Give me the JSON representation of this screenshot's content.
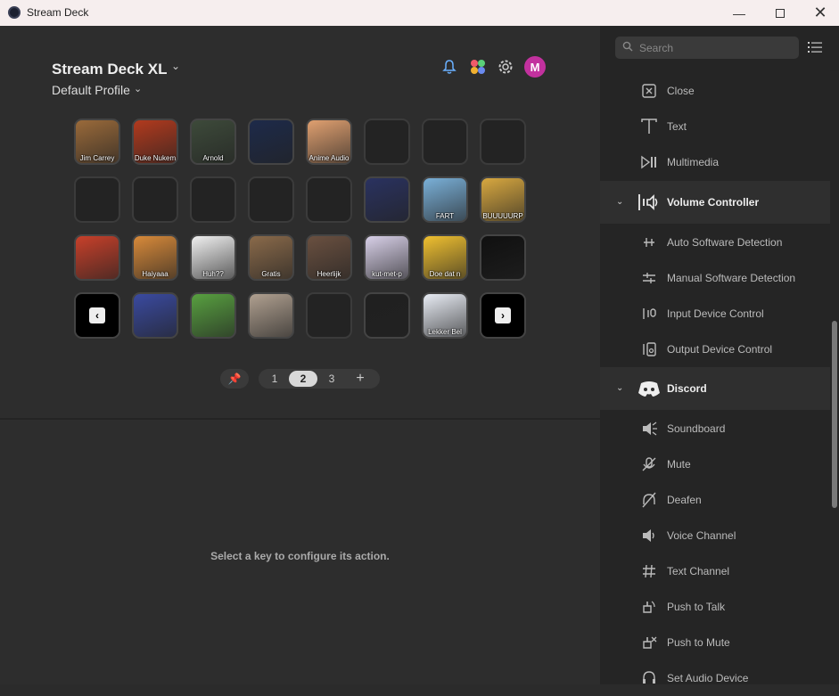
{
  "window": {
    "title": "Stream Deck"
  },
  "deck": {
    "name": "Stream Deck XL",
    "profile": "Default Profile"
  },
  "header_icons": [
    "bell-icon",
    "plugin-store-icon",
    "gear-icon"
  ],
  "avatar_initial": "M",
  "keys": [
    {
      "label": "Jim Carrey",
      "bg": "#9a6a3a"
    },
    {
      "label": "Duke Nukem",
      "bg": "#b23a1e"
    },
    {
      "label": "Arnold",
      "bg": "#3d4a3a"
    },
    {
      "label": "",
      "bg": "#1d2a4a"
    },
    {
      "label": "Anime Audio",
      "bg": "#e0a070"
    },
    {
      "label": "",
      "bg": ""
    },
    {
      "label": "",
      "bg": ""
    },
    {
      "label": "",
      "bg": ""
    },
    {
      "label": "",
      "bg": ""
    },
    {
      "label": "",
      "bg": ""
    },
    {
      "label": "",
      "bg": ""
    },
    {
      "label": "",
      "bg": ""
    },
    {
      "label": "",
      "bg": ""
    },
    {
      "label": "",
      "bg": "#2a3260"
    },
    {
      "label": "FART",
      "bg": "#7ab0d8"
    },
    {
      "label": "BUUUUURP",
      "bg": "#d8a840"
    },
    {
      "label": "",
      "bg": "#c8402a"
    },
    {
      "label": "Haiyaaa",
      "bg": "#d88a3a"
    },
    {
      "label": "Huh??",
      "bg": "#f0f0f0"
    },
    {
      "label": "Gratis",
      "bg": "#8a6a4a"
    },
    {
      "label": "Heerlijk",
      "bg": "#6a5040"
    },
    {
      "label": "kut-met-p",
      "bg": "#d8d0e8"
    },
    {
      "label": "Doe dat n",
      "bg": "#f0c030"
    },
    {
      "label": "",
      "bg": "#101010"
    },
    {
      "label": "",
      "bg": "nav-prev"
    },
    {
      "label": "",
      "bg": "#3a4aa0"
    },
    {
      "label": "",
      "bg": "#58a040"
    },
    {
      "label": "",
      "bg": "#b0a090"
    },
    {
      "label": "",
      "bg": ""
    },
    {
      "label": "",
      "bg": "#202020"
    },
    {
      "label": "Lekker Bel",
      "bg": "#e8ecf4"
    },
    {
      "label": "",
      "bg": "nav-next"
    }
  ],
  "pager": {
    "pages": [
      "1",
      "2",
      "3"
    ],
    "active": "2",
    "add": "+"
  },
  "hint": "Select a key to configure its action.",
  "sidebar": {
    "search_placeholder": "Search",
    "items_top": [
      {
        "label": "Close",
        "icon": "close-box-icon"
      },
      {
        "label": "Text",
        "icon": "text-icon"
      },
      {
        "label": "Multimedia",
        "icon": "play-pause-icon"
      }
    ],
    "volume": {
      "title": "Volume Controller",
      "items": [
        {
          "label": "Auto Software Detection",
          "icon": "auto-slider-icon"
        },
        {
          "label": "Manual Software Detection",
          "icon": "manual-slider-icon"
        },
        {
          "label": "Input Device Control",
          "icon": "input-device-icon"
        },
        {
          "label": "Output Device Control",
          "icon": "output-device-icon"
        }
      ]
    },
    "discord": {
      "title": "Discord",
      "items": [
        {
          "label": "Soundboard",
          "icon": "soundboard-icon"
        },
        {
          "label": "Mute",
          "icon": "mic-mute-icon"
        },
        {
          "label": "Deafen",
          "icon": "deafen-icon"
        },
        {
          "label": "Voice Channel",
          "icon": "speaker-icon"
        },
        {
          "label": "Text Channel",
          "icon": "hash-icon"
        },
        {
          "label": "Push to Talk",
          "icon": "push-to-talk-icon"
        },
        {
          "label": "Push to Mute",
          "icon": "push-to-mute-icon"
        },
        {
          "label": "Set Audio Device",
          "icon": "headset-icon"
        }
      ]
    }
  }
}
